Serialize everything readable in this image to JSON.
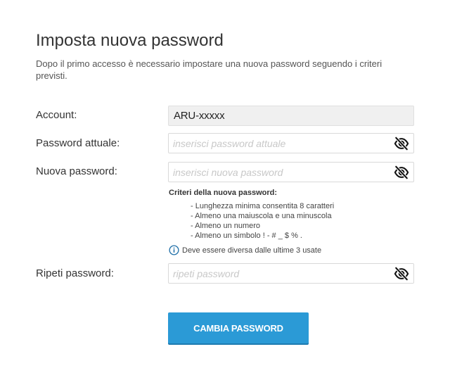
{
  "header": {
    "title": "Imposta nuova password",
    "subtitle": "Dopo il primo accesso è necessario impostare una nuova password seguendo i criteri previsti."
  },
  "form": {
    "account_label": "Account:",
    "account_value": "ARU-xxxxx",
    "current_password_label": "Password attuale:",
    "current_password_placeholder": "inserisci password attuale",
    "new_password_label": "Nuova password:",
    "new_password_placeholder": "inserisci nuova password",
    "repeat_password_label": "Ripeti password:",
    "repeat_password_placeholder": "ripeti password"
  },
  "criteria": {
    "title": "Criteri della nuova password:",
    "items": [
      "- Lunghezza minima consentita 8 caratteri",
      "- Almeno una maiuscola e una minuscola",
      "- Almeno un numero",
      "- Almeno un simbolo ! - # _ $ % ."
    ],
    "note": "Deve essere diversa dalle ultime 3 usate"
  },
  "actions": {
    "submit_label": "CAMBIA PASSWORD"
  },
  "icons": {
    "visibility_toggle": "eye-slash-icon",
    "info": "info-circle-icon"
  },
  "colors": {
    "primary": "#2b9ad6",
    "readonly_bg": "#f0f0f0",
    "placeholder": "#c8c8c8"
  }
}
